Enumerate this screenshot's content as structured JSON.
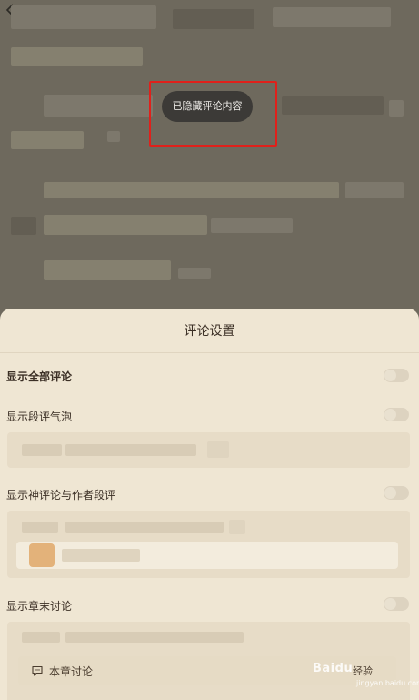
{
  "toast": {
    "text": "已隐藏评论内容"
  },
  "sheet": {
    "title": "评论设置",
    "rows": [
      {
        "label": "显示全部评论",
        "on": false
      },
      {
        "label": "显示段评气泡",
        "on": false
      },
      {
        "label": "显示神评论与作者段评",
        "on": false
      },
      {
        "label": "显示章末讨论",
        "on": false
      }
    ],
    "chapter_discussion": {
      "label": "本章讨论",
      "right_label": "经验"
    }
  },
  "watermark": {
    "brand": "Baidu",
    "sub": "jingyan.baidu.com"
  },
  "colors": {
    "accent_red": "#e0201b",
    "sheet_bg": "#efe6d3",
    "toast_bg": "#3c3a37"
  }
}
